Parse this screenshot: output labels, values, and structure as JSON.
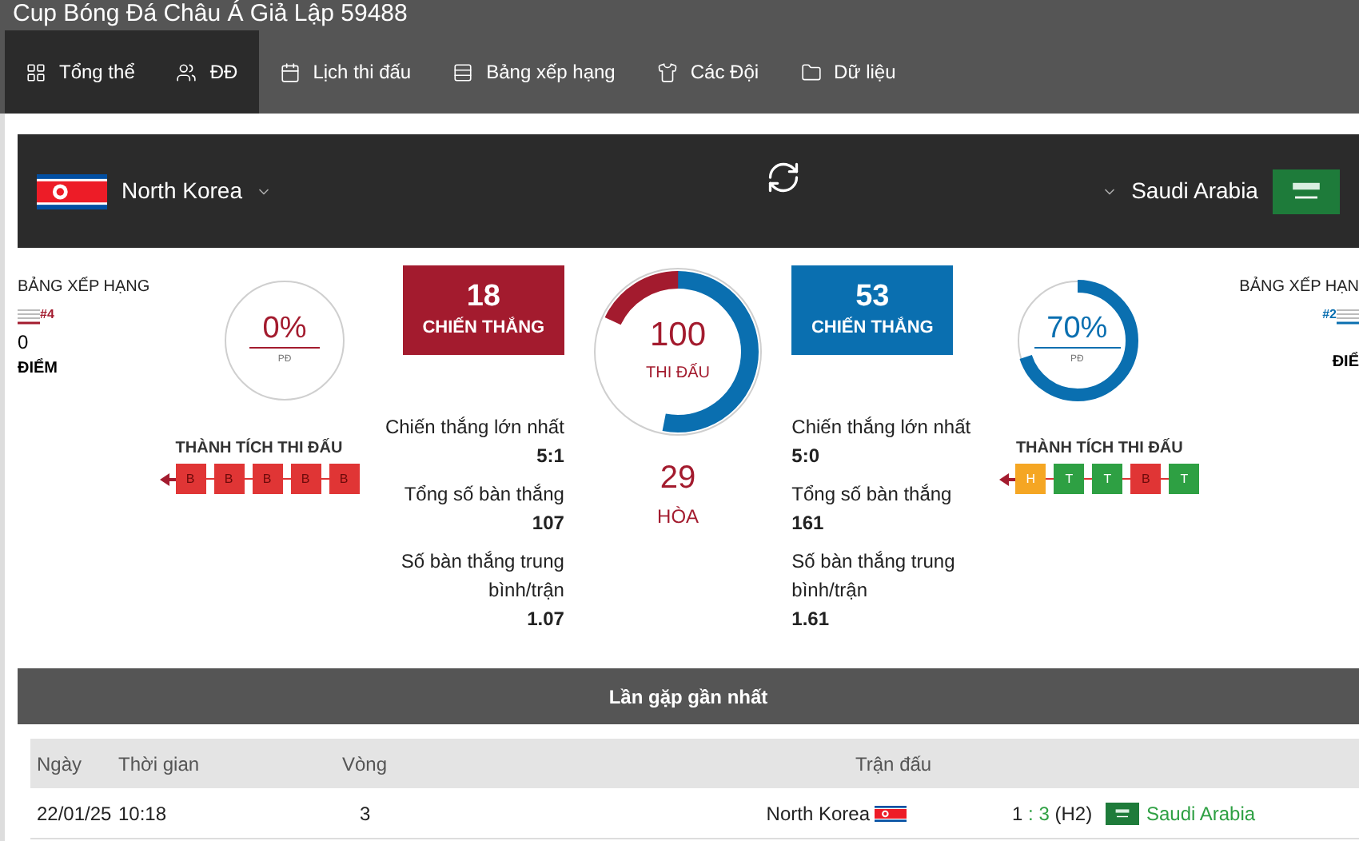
{
  "title": "Cup Bóng Đá Châu Á Giả Lập 59488",
  "tabs": [
    {
      "label": "Tổng thể",
      "selected": true
    },
    {
      "label": "ĐĐ",
      "selected": true
    },
    {
      "label": "Lịch thi đấu",
      "selected": false
    },
    {
      "label": "Bảng xếp hạng",
      "selected": false
    },
    {
      "label": "Các Đội",
      "selected": false
    },
    {
      "label": "Dữ liệu",
      "selected": false
    }
  ],
  "teams": [
    {
      "name": "North Korea",
      "color": "#a31b2e",
      "rank_heading": "BẢNG XẾP HẠNG",
      "rank": "#4",
      "points": "0",
      "points_label": "ĐIỂM",
      "win_rate": {
        "text": "0%",
        "label": "PĐ",
        "level": 0
      },
      "form_heading": "THÀNH TÍCH THI ĐẤU",
      "form": [
        {
          "letter": "B",
          "kind": "loss"
        },
        {
          "letter": "B",
          "kind": "loss"
        },
        {
          "letter": "B",
          "kind": "loss"
        },
        {
          "letter": "B",
          "kind": "loss"
        },
        {
          "letter": "B",
          "kind": "loss"
        }
      ],
      "wins": "18",
      "wins_label": "CHIẾN THẮNG",
      "wins_arc": {
        "level": 0.18
      },
      "stats": [
        {
          "label": "Chiến thắng lớn nhất",
          "value": "5:1"
        },
        {
          "label": "Tổng số bàn thắng",
          "value": "107"
        },
        {
          "label": "Số bàn thắng trung bình/trận",
          "value": "1.07"
        }
      ]
    },
    {
      "name": "Saudi Arabia",
      "color": "#0a6fb0",
      "rank_heading": "BẢNG XẾP HẠN",
      "rank": "#2",
      "points_label": "ĐIỂ",
      "win_rate": {
        "text": "70%",
        "label": "PĐ",
        "level": 0.7
      },
      "form_heading": "THÀNH TÍCH THI ĐẤU",
      "form": [
        {
          "letter": "H",
          "kind": "draw"
        },
        {
          "letter": "T",
          "kind": "win"
        },
        {
          "letter": "T",
          "kind": "win"
        },
        {
          "letter": "B",
          "kind": "loss"
        },
        {
          "letter": "T",
          "kind": "win"
        }
      ],
      "wins": "53",
      "wins_label": "CHIẾN THẮNG",
      "wins_arc": {
        "level": 0.53
      },
      "stats": [
        {
          "label": "Chiến thắng lớn nhất",
          "value": "5:0"
        },
        {
          "label": "Tổng số bàn thắng",
          "value": "161"
        },
        {
          "label": "Số bàn thắng trung bình/trận",
          "value": "1.61"
        }
      ]
    }
  ],
  "head_to_head": {
    "matches": "100",
    "matches_label": "THI ĐẤU",
    "draws": "29",
    "draws_label": "HÒA"
  },
  "recent": {
    "heading": "Lần gặp gần nhất",
    "columns": [
      "Ngày",
      "Thời gian",
      "Vòng",
      "Trận đấu"
    ],
    "rows": [
      {
        "date": "22/01/25",
        "time": "10:18",
        "round": "3",
        "home": "North Korea",
        "home_score": "1",
        "separator": ":",
        "away_score": "3",
        "note": "(H2)",
        "away": "Saudi Arabia",
        "away_won": true
      }
    ]
  }
}
